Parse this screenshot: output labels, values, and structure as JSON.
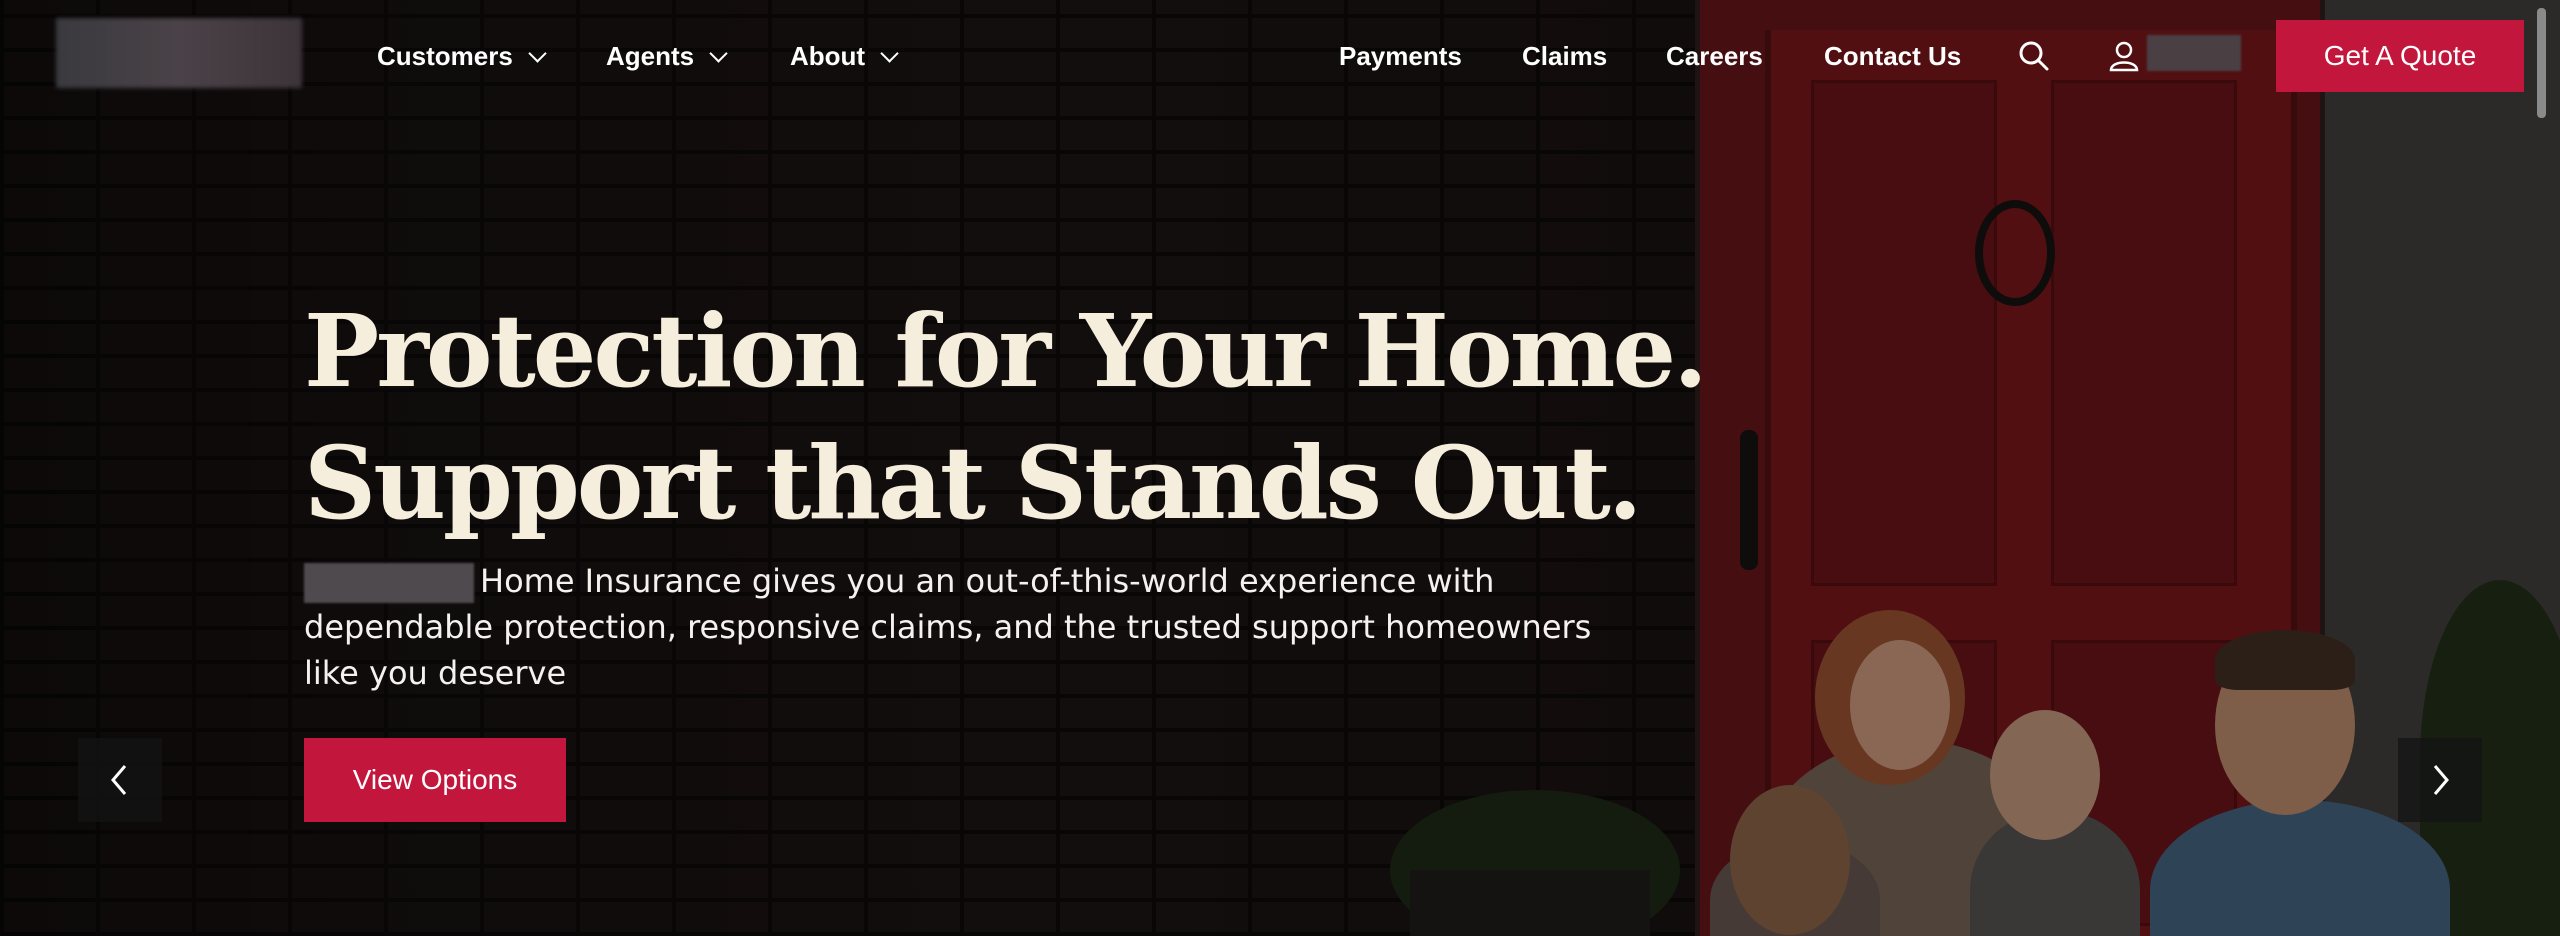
{
  "header": {
    "nav_left": [
      {
        "label": "Customers"
      },
      {
        "label": "Agents"
      },
      {
        "label": "About"
      }
    ],
    "nav_right": [
      {
        "label": "Payments"
      },
      {
        "label": "Claims"
      },
      {
        "label": "Careers"
      },
      {
        "label": "Contact Us"
      }
    ],
    "quote_button": "Get A Quote",
    "icons": [
      "search-icon",
      "user-icon",
      "chevron-down-icon"
    ]
  },
  "hero": {
    "headline_line1": "Protection for Your Home.",
    "headline_line2": "Support that Stands Out.",
    "subtext": "Home Insurance gives you an out-of-this-world experience with dependable protection, responsive claims, and the trusted support homeowners like you deserve",
    "cta_button": "View Options",
    "prev_icon": "chevron-left-icon",
    "next_icon": "chevron-right-icon"
  },
  "colors": {
    "accent": "#c3163c",
    "headline": "#f6eedd",
    "door": "#6e1519"
  }
}
